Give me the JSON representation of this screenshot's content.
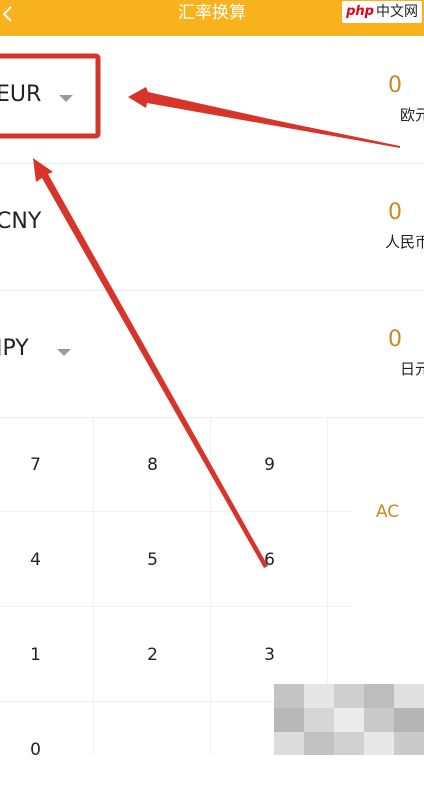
{
  "topbar": {
    "title": "汇率换算",
    "watermark_php": "php",
    "watermark_cn": "中文网",
    "color": "#f7b21d"
  },
  "currencies": [
    {
      "code": "EUR",
      "value": "0",
      "name": "欧元",
      "has_dropdown": true
    },
    {
      "code": "CNY",
      "value": "0",
      "name": "人民币",
      "has_dropdown": false
    },
    {
      "code": "JPY",
      "value": "0",
      "name": "日元",
      "has_dropdown": true
    }
  ],
  "keypad": {
    "keys": [
      "7",
      "8",
      "9",
      "4",
      "5",
      "6",
      "1",
      "2",
      "3",
      "0"
    ],
    "clear": "AC"
  },
  "colors": {
    "value": "#c8891e",
    "annotation": "#d7342a"
  }
}
